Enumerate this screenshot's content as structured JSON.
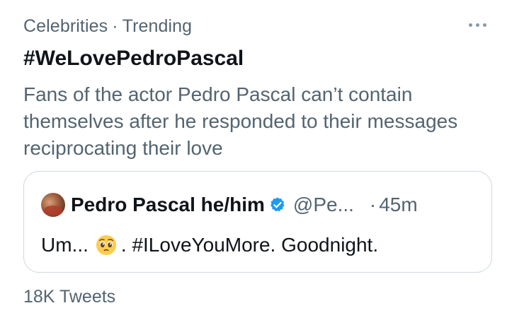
{
  "trend": {
    "category": "Celebrities",
    "separator": "·",
    "status": "Trending",
    "hashtag": "#WeLovePedroPascal",
    "description": "Fans of the actor Pedro Pascal can’t contain themselves after he responded to their messages reciprocating their love",
    "tweet_count": "18K Tweets",
    "more_icon": "more-horizontal-icon"
  },
  "quoted_tweet": {
    "author_name": "Pedro Pascal he/him",
    "verified_icon": "verified-badge-icon",
    "handle": "@Pe...",
    "separator": "·",
    "time": "45m",
    "text_before": "Um...",
    "emoji": "pleading-face-emoji",
    "text_after": ". #ILoveYouMore. Goodnight."
  },
  "colors": {
    "primary_text": "#0f1419",
    "secondary_text": "#536471",
    "verified_blue": "#1d9bf0",
    "border": "#cfd9de"
  }
}
